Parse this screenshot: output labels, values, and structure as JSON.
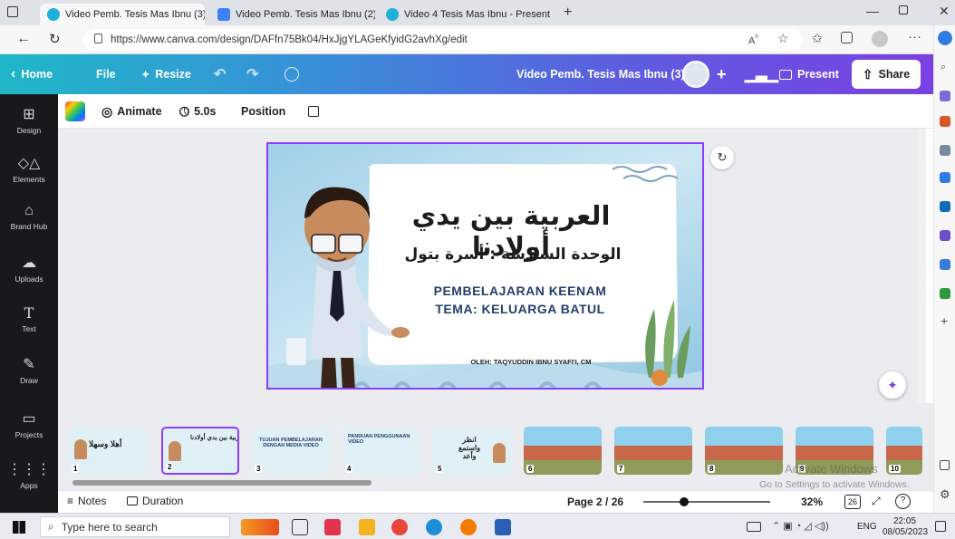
{
  "browser": {
    "tabs": [
      {
        "title": "Video Pemb. Tesis Mas Ibnu (3) -",
        "active": true
      },
      {
        "title": "Video Pemb. Tesis Mas Ibnu (2) -",
        "active": false
      },
      {
        "title": "Video 4 Tesis Mas Ibnu - Present",
        "active": false
      }
    ],
    "url": "https://www.canva.com/design/DAFfn75Bk04/HxJjgYLAGeKfyidG2avhXg/edit"
  },
  "header": {
    "home": "Home",
    "file": "File",
    "resize": "Resize",
    "design_title": "Video Pemb. Tesis Mas Ibnu (3)",
    "present": "Present",
    "share": "Share"
  },
  "rail": [
    {
      "label": "Design",
      "icon": "layout-icon"
    },
    {
      "label": "Elements",
      "icon": "shapes-icon"
    },
    {
      "label": "Brand Hub",
      "icon": "brand-icon"
    },
    {
      "label": "Uploads",
      "icon": "cloud-upload-icon"
    },
    {
      "label": "Text",
      "icon": "text-icon"
    },
    {
      "label": "Draw",
      "icon": "draw-icon"
    },
    {
      "label": "Projects",
      "icon": "folder-icon"
    },
    {
      "label": "Apps",
      "icon": "apps-grid-icon"
    }
  ],
  "toolbar": {
    "animate": "Animate",
    "duration": "5.0s",
    "position": "Position"
  },
  "slide": {
    "title_ar": "العربية بين يدي أولادنا",
    "subtitle_ar": "الوحدة السادسة : أسرة بتول",
    "line1": "PEMBELAJARAN KEENAM",
    "line2": "TEMA: KELUARGA BATUL",
    "author": "OLEH: TAQYUDDIN IBNU SYAFI'I, CM"
  },
  "thumbnails": [
    {
      "num": "1",
      "title": "أهلا وسهلا"
    },
    {
      "num": "2",
      "title": "العربية بين يدي أولادنا"
    },
    {
      "num": "3",
      "title": "TUJUAN PEMBELAJARAN DENGAN MEDIA VIDEO"
    },
    {
      "num": "4",
      "title": "PANDUAN PENGGUNAAN VIDEO"
    },
    {
      "num": "5",
      "title": "انظر واستمع وأعد"
    },
    {
      "num": "6",
      "title": ""
    },
    {
      "num": "7",
      "title": ""
    },
    {
      "num": "8",
      "title": ""
    },
    {
      "num": "9",
      "title": ""
    },
    {
      "num": "10",
      "title": ""
    }
  ],
  "bottombar": {
    "notes": "Notes",
    "duration": "Duration",
    "page": "Page 2 / 26",
    "zoom": "32%",
    "pages_count": "26",
    "watermark1": "Activate Windows",
    "watermark2": "Go to Settings to activate Windows."
  },
  "taskbar": {
    "search_placeholder": "Type here to search",
    "lang": "ENG",
    "time": "22:05",
    "date": "08/05/2023"
  },
  "colors": {
    "accent_purple": "#8b3dff",
    "rail_bg": "#18191b",
    "header_start": "#1fb7c8",
    "header_end": "#7b3fe4"
  }
}
